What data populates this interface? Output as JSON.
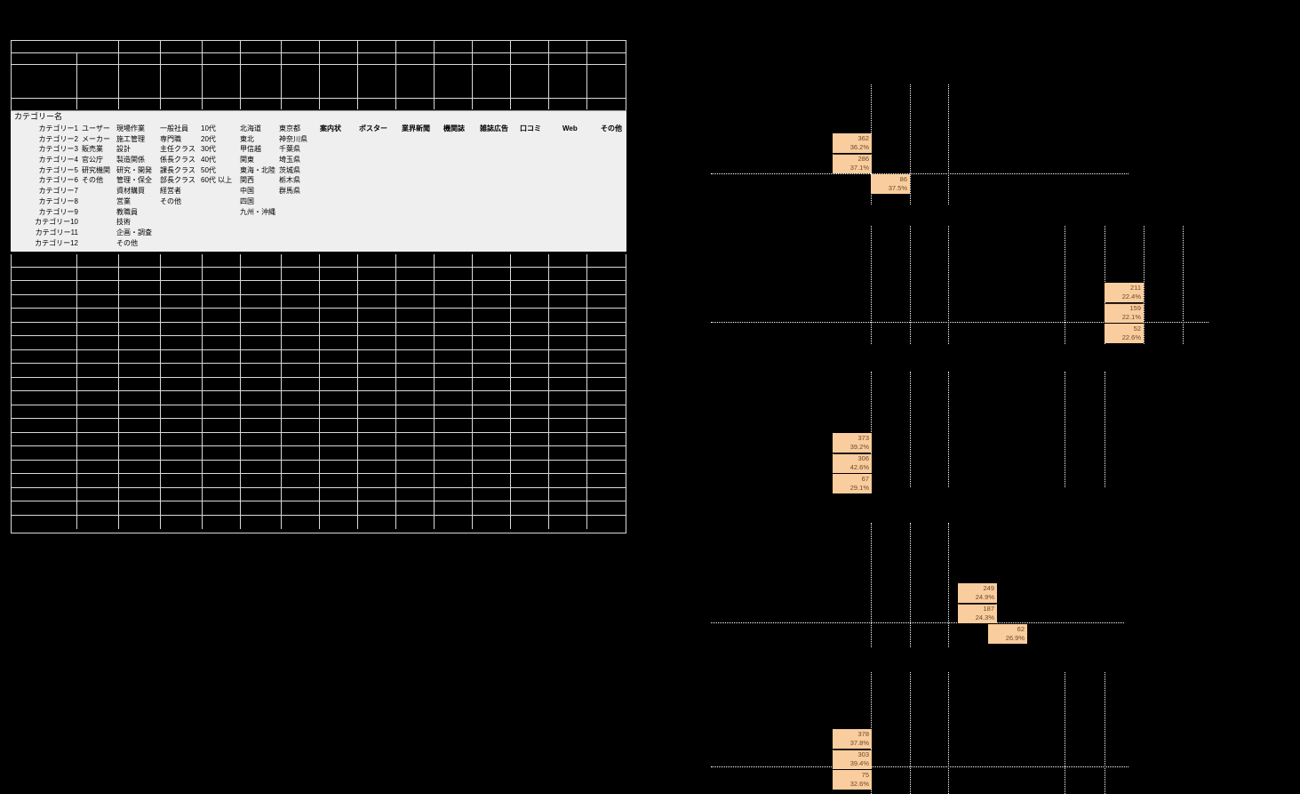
{
  "sheet": {
    "top_block": {
      "rows": 4,
      "cols": 15
    },
    "bottom_block": {
      "rows": 20,
      "cols": 15
    }
  },
  "legend": {
    "title": "カテゴリー名",
    "categories": [
      "カテゴリー1",
      "カテゴリー2",
      "カテゴリー3",
      "カテゴリー4",
      "カテゴリー5",
      "カテゴリー6",
      "カテゴリー7",
      "カテゴリー8",
      "カテゴリー9",
      "カテゴリー10",
      "カテゴリー11",
      "カテゴリー12"
    ],
    "col_business": [
      "ユーザー",
      "メーカー",
      "販売業",
      "官公庁",
      "研究機関",
      "その他"
    ],
    "col_job": [
      "現場作業",
      "施工管理",
      "設計",
      "製造関係",
      "研究・開発",
      "管理・保全",
      "資材購買",
      "営業",
      "教職員",
      "技術",
      "企画・調査",
      "その他"
    ],
    "col_position": [
      "一般社員",
      "専門職",
      "主任クラス",
      "係長クラス",
      "課長クラス",
      "部長クラス",
      "経営者",
      "その他"
    ],
    "col_age": [
      "10代",
      "20代",
      "30代",
      "40代",
      "50代",
      "60代 以上"
    ],
    "col_region": [
      "北海道",
      "東北",
      "甲信越",
      "関東",
      "東海・北陸",
      "関西",
      "中国",
      "四国",
      "九州・沖縄"
    ],
    "col_pref": [
      "東京都",
      "神奈川県",
      "千葉県",
      "埼玉県",
      "茨城県",
      "栃木県",
      "群馬県"
    ],
    "col_media": [
      "案内状",
      "ポスター",
      "業界新聞",
      "機関誌",
      "雑誌広告",
      "口コミ",
      "Web",
      "その他"
    ]
  },
  "chart_data": {
    "type": "bar",
    "title": "",
    "xlabel": "",
    "ylabel": "",
    "grid": true,
    "legend_position": "none",
    "bar_color": "#facd9e",
    "blocks": [
      {
        "name": "block-1",
        "bars": [
          {
            "value": "362",
            "percent": "36.2%"
          },
          {
            "value": "286",
            "percent": "37.1%"
          },
          {
            "value": "86",
            "percent": "37.5%"
          }
        ]
      },
      {
        "name": "block-2",
        "bars": [
          {
            "value": "211",
            "percent": "22.4%"
          },
          {
            "value": "159",
            "percent": "22.1%"
          },
          {
            "value": "52",
            "percent": "22.6%"
          }
        ]
      },
      {
        "name": "block-3",
        "bars": [
          {
            "value": "373",
            "percent": "39.2%"
          },
          {
            "value": "306",
            "percent": "42.6%"
          },
          {
            "value": "67",
            "percent": "29.1%"
          }
        ]
      },
      {
        "name": "block-4",
        "bars": [
          {
            "value": "249",
            "percent": "24.9%"
          },
          {
            "value": "187",
            "percent": "24.3%"
          },
          {
            "value": "62",
            "percent": "26.9%"
          }
        ]
      },
      {
        "name": "block-5",
        "bars": [
          {
            "value": "378",
            "percent": "37.8%"
          },
          {
            "value": "303",
            "percent": "39.4%"
          },
          {
            "value": "75",
            "percent": "32.6%"
          }
        ]
      }
    ]
  }
}
